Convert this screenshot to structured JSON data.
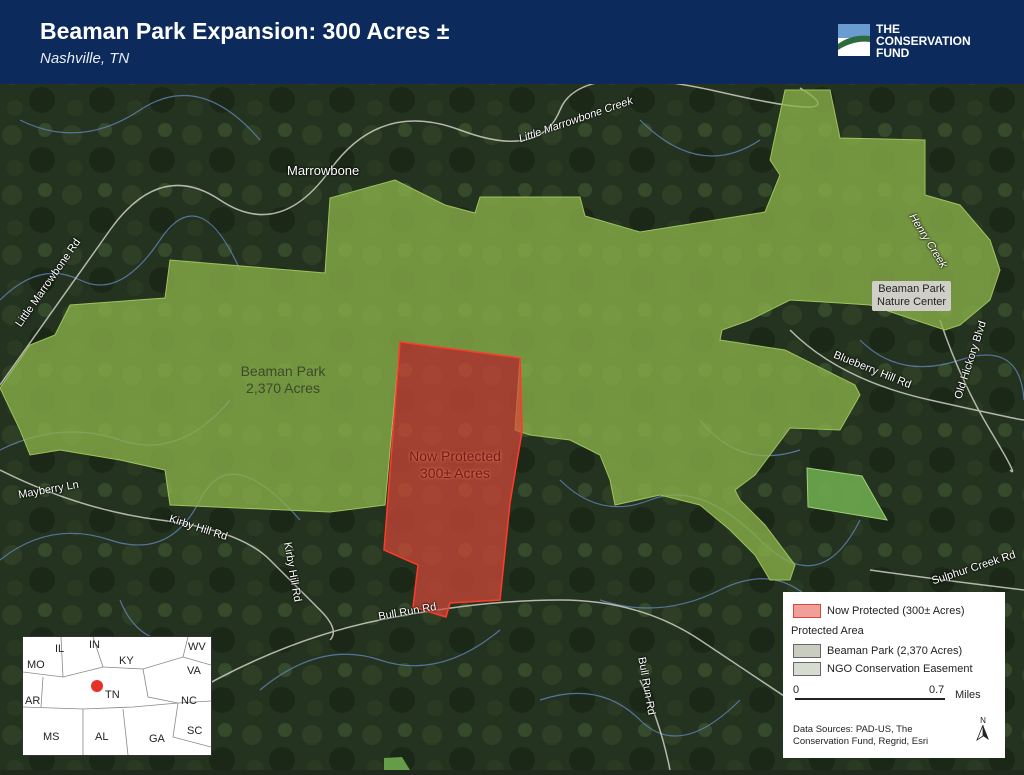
{
  "header": {
    "title": "Beaman Park Expansion: 300 Acres ±",
    "subtitle": "Nashville, TN",
    "logo_lines": [
      "THE",
      "CONSERVATION",
      "FUND"
    ]
  },
  "colors": {
    "header_bg": "#0d2a5c",
    "beaman_park_fill": "#8bb14a",
    "now_protected_fill": "#d9473a",
    "easement_fill": "#6ea84c"
  },
  "map": {
    "place_labels": {
      "marrowbone": "Marrowbone",
      "little_marrowbone_creek": "Little Marrowbone Creek",
      "little_marrowbone_rd": "Little Marrowbone Rd",
      "henry_creek": "Henry Creek",
      "blueberry_hill_rd": "Blueberry Hill Rd",
      "old_hickory_blvd": "Old Hickory Blvd",
      "mayberry_ln": "Mayberry Ln",
      "kirby_hill_rd_1": "Kirby Hill Rd",
      "kirby_hill_rd_2": "Kirby Hill Rd",
      "bull_run_rd_1": "Bull Run Rd",
      "bull_run_rd_2": "Bull Run Rd",
      "sulphur_creek_rd": "Sulphur Creek Rd"
    },
    "beaman_park_label": [
      "Beaman Park",
      "2,370 Acres"
    ],
    "now_protected_label": [
      "Now Protected",
      "300± Acres"
    ],
    "nature_center_label": [
      "Beaman Park",
      "Nature Center"
    ]
  },
  "inset": {
    "states": [
      "IL",
      "IN",
      "KY",
      "WV",
      "MO",
      "VA",
      "AR",
      "TN",
      "NC",
      "MS",
      "AL",
      "GA",
      "SC"
    ]
  },
  "legend": {
    "now_protected": "Now Protected (300± Acres)",
    "group_title": "Protected Area",
    "beaman_park": "Beaman Park (2,370 Acres)",
    "ngo_easement": "NGO Conservation Easement",
    "scale_start": "0",
    "scale_end": "0.7",
    "scale_unit": "Miles",
    "sources": "Data Sources: PAD-US, The Conservation Fund, Regrid, Esri",
    "north": "N"
  }
}
